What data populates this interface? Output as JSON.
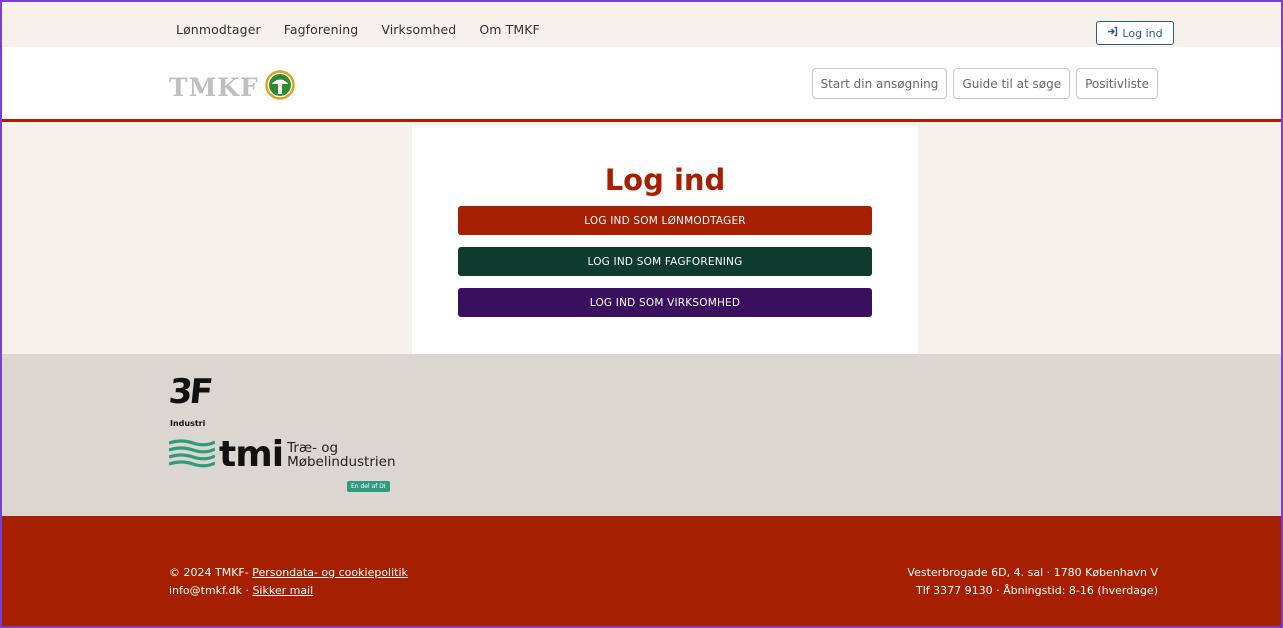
{
  "topnav": {
    "items": [
      "Lønmodtager",
      "Fagforening",
      "Virksomhed",
      "Om TMKF"
    ],
    "login_label": "Log ind"
  },
  "header": {
    "logo_text": "TMKF",
    "buttons": [
      "Start din ansøgning",
      "Guide til at søge",
      "Positivliste"
    ]
  },
  "main": {
    "title": "Log ind",
    "buttons": [
      "LOG IND SOM LØNMODTAGER",
      "LOG IND SOM FAGFORENING",
      "LOG IND SOM VIRKSOMHED"
    ]
  },
  "partners": {
    "logo_3f": "3F",
    "logo_3f_sub": "Industri",
    "tmi_text": "tmi",
    "tmi_sub_1": "Træ- og",
    "tmi_sub_2": "Møbelindustrien",
    "tmi_badge": "En del af DI"
  },
  "footer": {
    "copyright": "© 2024 TMKF-",
    "privacy_link": "Persondata- og cookiepolitik",
    "email": "info@tmkf.dk",
    "separator": " · ",
    "secure_mail": "Sikker mail",
    "address": "Vesterbrogade 6D, 4. sal · 1780 København V",
    "phone_hours": "Tlf 3377 9130 · Åbningstid: 8-16 (hverdage)"
  },
  "colors": {
    "brand_red": "#a61f00",
    "brand_green": "#0e3b2e",
    "brand_purple": "#3b0f5f",
    "logo_green": "#2e8b2e",
    "logo_orange": "#e0a020"
  },
  "icons": {
    "login": "sign-in-icon",
    "logo": "tmkf-tree-logo-icon",
    "tmi_waves": "tmi-waves-icon"
  }
}
